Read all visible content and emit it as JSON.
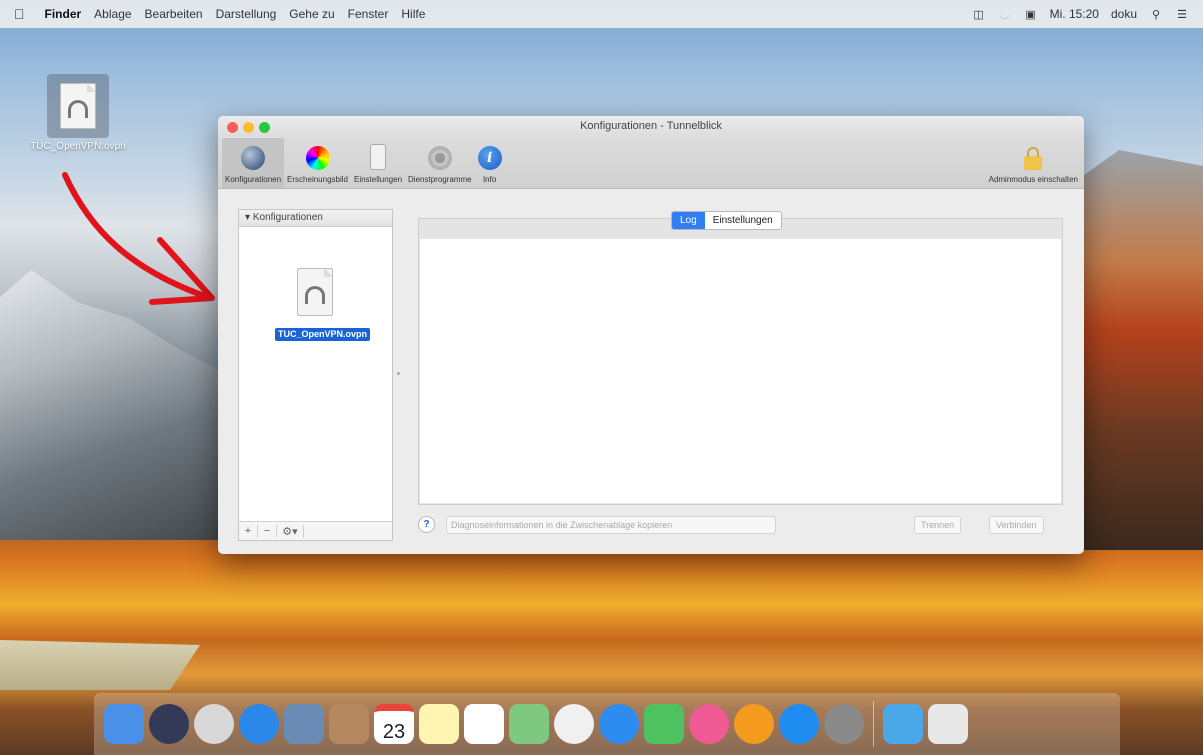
{
  "menubar": {
    "apple": "",
    "items": [
      "Finder",
      "Ablage",
      "Bearbeiten",
      "Darstellung",
      "Gehe zu",
      "Fenster",
      "Hilfe"
    ],
    "datetime": "Mi. 15:20",
    "user": "doku"
  },
  "desktop": {
    "file_name": "TUC_OpenVPN.ovpn"
  },
  "window": {
    "title": "Konfigurationen - Tunnelblick",
    "toolbar": {
      "items": [
        "Konfigurationen",
        "Erscheinungsbild",
        "Einstellungen",
        "Dienstprogramme",
        "Info"
      ],
      "admin": "Adminmodus einschalten"
    },
    "left_panel": {
      "header": "Konfigurationen",
      "selected_file": "TUC_OpenVPN.ovpn",
      "footer_add": "+",
      "footer_remove": "−",
      "footer_gear": "⚙▾"
    },
    "tabs": [
      "Log",
      "Einstellungen"
    ],
    "help": "?",
    "buttons": {
      "diagnose": "Diagnoseinformationen in die Zwischenablage kopieren",
      "disconnect": "Trennen",
      "connect": "Verbinden"
    }
  },
  "dock": {
    "icons": [
      "finder-icon",
      "siri-icon",
      "launchpad-icon",
      "safari-icon",
      "photo-viewer-icon",
      "contacts-icon",
      "calendar-icon",
      "notes-icon",
      "reminders-icon",
      "maps-icon",
      "photos-icon",
      "messages-icon",
      "facetime-icon",
      "itunes-icon",
      "ibooks-icon",
      "app-store-icon",
      "system-preferences-icon",
      "downloads-folder-icon",
      "trash-icon"
    ],
    "colors": [
      "#4a8fe8",
      "#333a58",
      "#d8d8d8",
      "#2b87e8",
      "#6a8bb5",
      "#b5875e",
      "#ffffff",
      "#fff5b0",
      "#ffffff",
      "#7ec880",
      "#f0f0f0",
      "#2e8cf0",
      "#4ec261",
      "#f05a94",
      "#f49a1f",
      "#1e8cf0",
      "#8a8a8a",
      "#4aa8e8",
      "#e8e8e8"
    ],
    "calendar_day": "23"
  }
}
